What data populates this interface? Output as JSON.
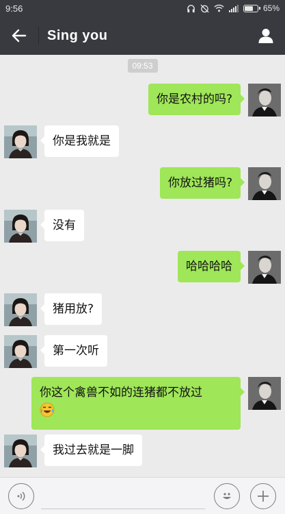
{
  "status_bar": {
    "time": "9:56",
    "battery": "65%",
    "battery_level": 0.65
  },
  "header": {
    "title": "Sing  you",
    "back_icon": "arrow-left-icon",
    "profile_icon": "person-icon"
  },
  "chat": {
    "timestamp": "09:53",
    "messages": [
      {
        "side": "right",
        "text": "你是农村的吗?"
      },
      {
        "side": "left",
        "text": "你是我就是"
      },
      {
        "side": "right",
        "text": "你放过猪吗?"
      },
      {
        "side": "left",
        "text": "没有"
      },
      {
        "side": "right",
        "text": "哈哈哈哈"
      },
      {
        "side": "left",
        "text": "猪用放?"
      },
      {
        "side": "left",
        "text": "第一次听"
      },
      {
        "side": "right",
        "text": "你这个禽兽不如的连猪都不放过",
        "emoji": "tears-of-joy-emoji"
      },
      {
        "side": "left",
        "text": "我过去就是一脚"
      }
    ]
  },
  "input_bar": {
    "voice_icon": "voice-icon",
    "emoji_icon": "smiley-icon",
    "more_icon": "plus-icon",
    "input_value": ""
  },
  "colors": {
    "header_bg": "#393a3f",
    "chat_bg": "#ebebeb",
    "sent_bubble": "#9fe658",
    "received_bubble": "#ffffff"
  }
}
